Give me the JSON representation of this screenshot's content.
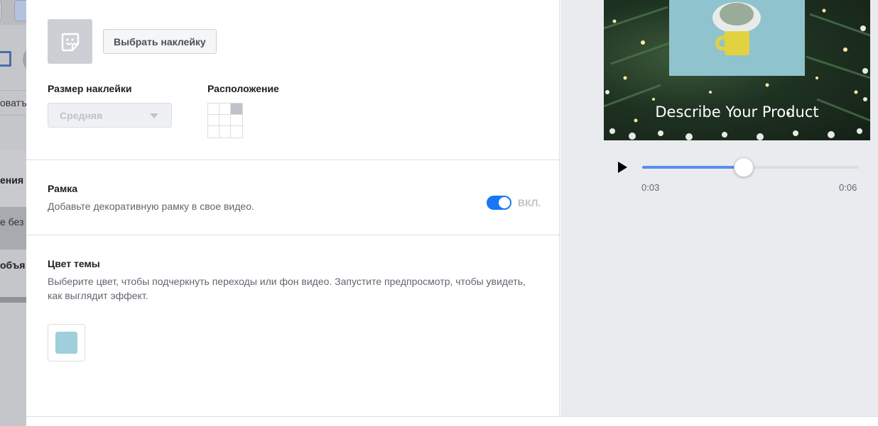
{
  "background_app": {
    "texts": [
      "оватъ",
      "ения",
      "е без",
      "объя"
    ]
  },
  "sticker": {
    "choose_button": "Выбрать наклейку",
    "size_label": "Размер наклейки",
    "size_value": "Средняя",
    "position_label": "Расположение",
    "position_grid_selected": "top-right"
  },
  "frame": {
    "title": "Рамка",
    "description": "Добавьте декоративную рамку в свое видео.",
    "toggle_label": "ВКЛ.",
    "toggle_on": true
  },
  "theme": {
    "title": "Цвет темы",
    "description": "Выберите цвет, чтобы подчеркнуть переходы или фон видео. Запустите предпросмотр, чтобы увидеть, как выглядит эффект.",
    "swatch_color": "#9ecfdb"
  },
  "preview": {
    "caption": "Describe Your Product",
    "current_time": "0:03",
    "total_time": "0:06",
    "progress": 0.47
  },
  "colors": {
    "accent": "#1877f2",
    "progress": "#5b8def"
  }
}
